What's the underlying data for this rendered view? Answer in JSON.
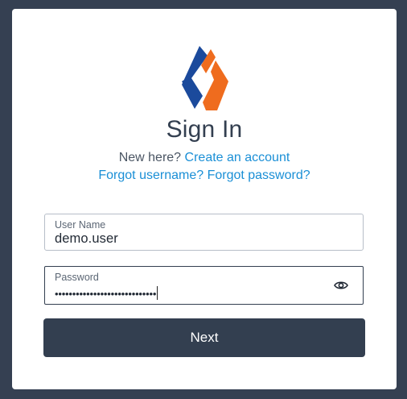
{
  "colors": {
    "background": "#354052",
    "card": "#ffffff",
    "primary": "#333f50",
    "link": "#1a8fd6",
    "logo_blue": "#1b4a9c",
    "logo_orange": "#ef6c1e"
  },
  "header": {
    "title": "Sign In",
    "new_here": "New here?",
    "create_account": "Create an account",
    "forgot_username": "Forgot username?",
    "forgot_password": "Forgot password?"
  },
  "form": {
    "username": {
      "label": "User Name",
      "value": "demo.user"
    },
    "password": {
      "label": "Password",
      "value": "•••••••••••••••••••••••••••••",
      "toggle_icon": "eye-icon"
    },
    "submit_label": "Next"
  }
}
